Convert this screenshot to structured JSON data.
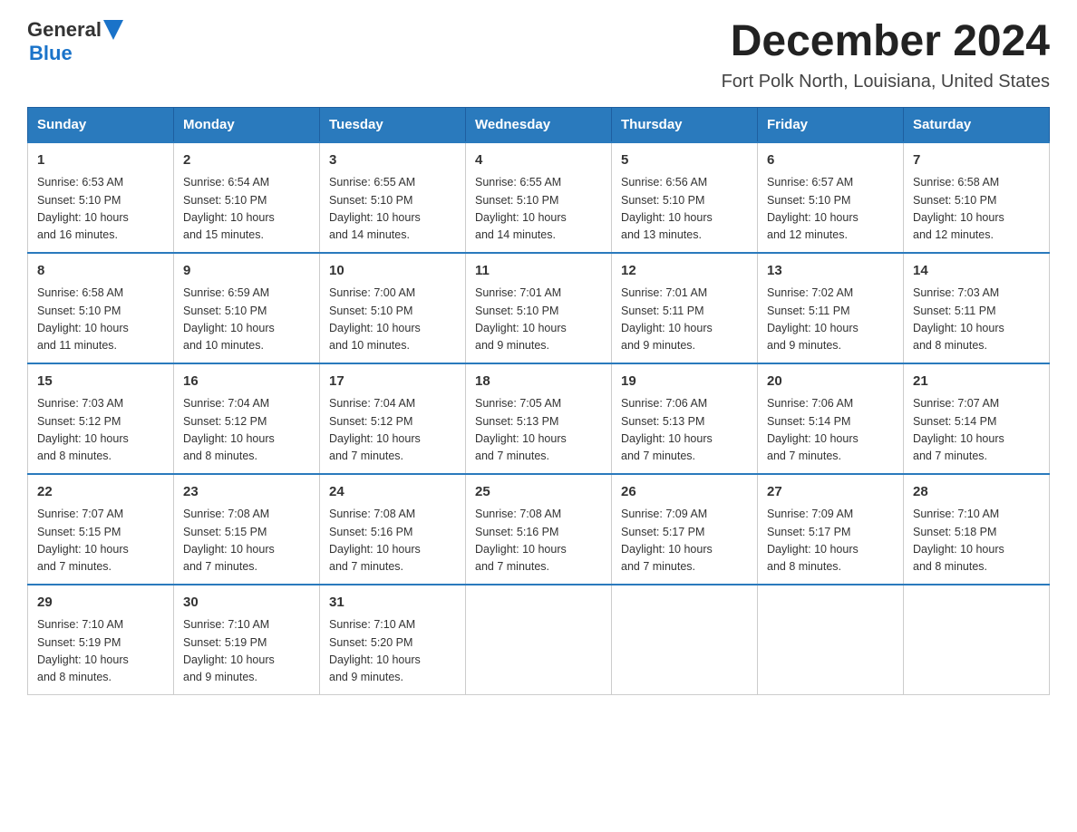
{
  "header": {
    "logo_general": "General",
    "logo_blue": "Blue",
    "month": "December 2024",
    "location": "Fort Polk North, Louisiana, United States"
  },
  "days_of_week": [
    "Sunday",
    "Monday",
    "Tuesday",
    "Wednesday",
    "Thursday",
    "Friday",
    "Saturday"
  ],
  "weeks": [
    [
      {
        "day": "1",
        "sunrise": "6:53 AM",
        "sunset": "5:10 PM",
        "daylight": "10 hours and 16 minutes."
      },
      {
        "day": "2",
        "sunrise": "6:54 AM",
        "sunset": "5:10 PM",
        "daylight": "10 hours and 15 minutes."
      },
      {
        "day": "3",
        "sunrise": "6:55 AM",
        "sunset": "5:10 PM",
        "daylight": "10 hours and 14 minutes."
      },
      {
        "day": "4",
        "sunrise": "6:55 AM",
        "sunset": "5:10 PM",
        "daylight": "10 hours and 14 minutes."
      },
      {
        "day": "5",
        "sunrise": "6:56 AM",
        "sunset": "5:10 PM",
        "daylight": "10 hours and 13 minutes."
      },
      {
        "day": "6",
        "sunrise": "6:57 AM",
        "sunset": "5:10 PM",
        "daylight": "10 hours and 12 minutes."
      },
      {
        "day": "7",
        "sunrise": "6:58 AM",
        "sunset": "5:10 PM",
        "daylight": "10 hours and 12 minutes."
      }
    ],
    [
      {
        "day": "8",
        "sunrise": "6:58 AM",
        "sunset": "5:10 PM",
        "daylight": "10 hours and 11 minutes."
      },
      {
        "day": "9",
        "sunrise": "6:59 AM",
        "sunset": "5:10 PM",
        "daylight": "10 hours and 10 minutes."
      },
      {
        "day": "10",
        "sunrise": "7:00 AM",
        "sunset": "5:10 PM",
        "daylight": "10 hours and 10 minutes."
      },
      {
        "day": "11",
        "sunrise": "7:01 AM",
        "sunset": "5:10 PM",
        "daylight": "10 hours and 9 minutes."
      },
      {
        "day": "12",
        "sunrise": "7:01 AM",
        "sunset": "5:11 PM",
        "daylight": "10 hours and 9 minutes."
      },
      {
        "day": "13",
        "sunrise": "7:02 AM",
        "sunset": "5:11 PM",
        "daylight": "10 hours and 9 minutes."
      },
      {
        "day": "14",
        "sunrise": "7:03 AM",
        "sunset": "5:11 PM",
        "daylight": "10 hours and 8 minutes."
      }
    ],
    [
      {
        "day": "15",
        "sunrise": "7:03 AM",
        "sunset": "5:12 PM",
        "daylight": "10 hours and 8 minutes."
      },
      {
        "day": "16",
        "sunrise": "7:04 AM",
        "sunset": "5:12 PM",
        "daylight": "10 hours and 8 minutes."
      },
      {
        "day": "17",
        "sunrise": "7:04 AM",
        "sunset": "5:12 PM",
        "daylight": "10 hours and 7 minutes."
      },
      {
        "day": "18",
        "sunrise": "7:05 AM",
        "sunset": "5:13 PM",
        "daylight": "10 hours and 7 minutes."
      },
      {
        "day": "19",
        "sunrise": "7:06 AM",
        "sunset": "5:13 PM",
        "daylight": "10 hours and 7 minutes."
      },
      {
        "day": "20",
        "sunrise": "7:06 AM",
        "sunset": "5:14 PM",
        "daylight": "10 hours and 7 minutes."
      },
      {
        "day": "21",
        "sunrise": "7:07 AM",
        "sunset": "5:14 PM",
        "daylight": "10 hours and 7 minutes."
      }
    ],
    [
      {
        "day": "22",
        "sunrise": "7:07 AM",
        "sunset": "5:15 PM",
        "daylight": "10 hours and 7 minutes."
      },
      {
        "day": "23",
        "sunrise": "7:08 AM",
        "sunset": "5:15 PM",
        "daylight": "10 hours and 7 minutes."
      },
      {
        "day": "24",
        "sunrise": "7:08 AM",
        "sunset": "5:16 PM",
        "daylight": "10 hours and 7 minutes."
      },
      {
        "day": "25",
        "sunrise": "7:08 AM",
        "sunset": "5:16 PM",
        "daylight": "10 hours and 7 minutes."
      },
      {
        "day": "26",
        "sunrise": "7:09 AM",
        "sunset": "5:17 PM",
        "daylight": "10 hours and 7 minutes."
      },
      {
        "day": "27",
        "sunrise": "7:09 AM",
        "sunset": "5:17 PM",
        "daylight": "10 hours and 8 minutes."
      },
      {
        "day": "28",
        "sunrise": "7:10 AM",
        "sunset": "5:18 PM",
        "daylight": "10 hours and 8 minutes."
      }
    ],
    [
      {
        "day": "29",
        "sunrise": "7:10 AM",
        "sunset": "5:19 PM",
        "daylight": "10 hours and 8 minutes."
      },
      {
        "day": "30",
        "sunrise": "7:10 AM",
        "sunset": "5:19 PM",
        "daylight": "10 hours and 9 minutes."
      },
      {
        "day": "31",
        "sunrise": "7:10 AM",
        "sunset": "5:20 PM",
        "daylight": "10 hours and 9 minutes."
      },
      null,
      null,
      null,
      null
    ]
  ],
  "labels": {
    "sunrise": "Sunrise:",
    "sunset": "Sunset:",
    "daylight": "Daylight:"
  }
}
